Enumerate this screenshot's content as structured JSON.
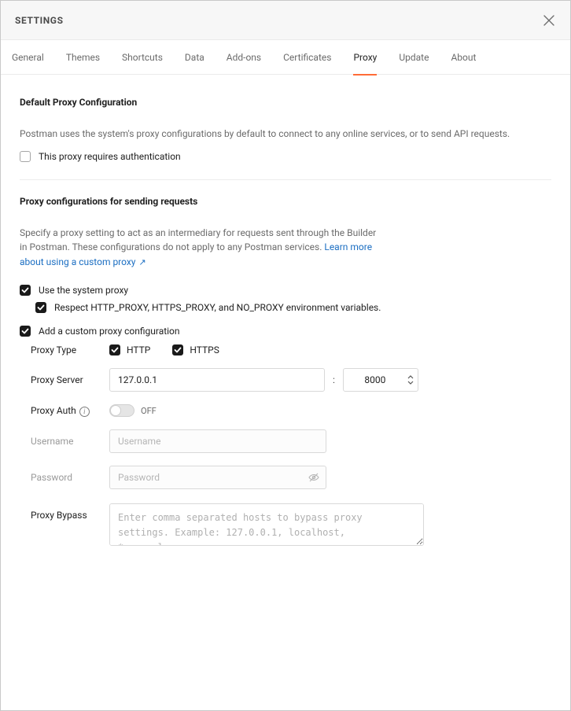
{
  "header": {
    "title": "SETTINGS"
  },
  "tabs": [
    {
      "id": "general",
      "label": "General",
      "active": false
    },
    {
      "id": "themes",
      "label": "Themes",
      "active": false
    },
    {
      "id": "shortcuts",
      "label": "Shortcuts",
      "active": false
    },
    {
      "id": "data",
      "label": "Data",
      "active": false
    },
    {
      "id": "addons",
      "label": "Add-ons",
      "active": false
    },
    {
      "id": "certificates",
      "label": "Certificates",
      "active": false
    },
    {
      "id": "proxy",
      "label": "Proxy",
      "active": true
    },
    {
      "id": "update",
      "label": "Update",
      "active": false
    },
    {
      "id": "about",
      "label": "About",
      "active": false
    }
  ],
  "defaultProxy": {
    "title": "Default Proxy Configuration",
    "desc": "Postman uses the system's proxy configurations by default to connect to any online services, or to send API requests.",
    "authRequired": {
      "label": "This proxy requires authentication",
      "checked": false
    }
  },
  "sendingRequests": {
    "title": "Proxy configurations for sending requests",
    "desc1": "Specify a proxy setting to act as an intermediary for requests sent through the Builder in Postman. These configurations do not apply to any Postman services.",
    "learnMore": "Learn more about using a custom proxy",
    "useSystemProxy": {
      "label": "Use the system proxy",
      "checked": true
    },
    "respectEnv": {
      "label": "Respect HTTP_PROXY, HTTPS_PROXY, and NO_PROXY environment variables.",
      "checked": true
    },
    "addCustom": {
      "label": "Add a custom proxy configuration",
      "checked": true
    }
  },
  "form": {
    "proxyType": {
      "label": "Proxy Type",
      "http": {
        "label": "HTTP",
        "checked": true
      },
      "https": {
        "label": "HTTPS",
        "checked": true
      }
    },
    "proxyServer": {
      "label": "Proxy Server",
      "host": "127.0.0.1",
      "port": "8000"
    },
    "proxyAuth": {
      "label": "Proxy Auth",
      "toggle": "OFF"
    },
    "username": {
      "label": "Username",
      "placeholder": "Username",
      "value": ""
    },
    "password": {
      "label": "Password",
      "placeholder": "Password",
      "value": ""
    },
    "bypass": {
      "label": "Proxy Bypass",
      "placeholder": "Enter comma separated hosts to bypass proxy settings. Example: 127.0.0.1, localhost, *.example.com",
      "value": ""
    }
  }
}
